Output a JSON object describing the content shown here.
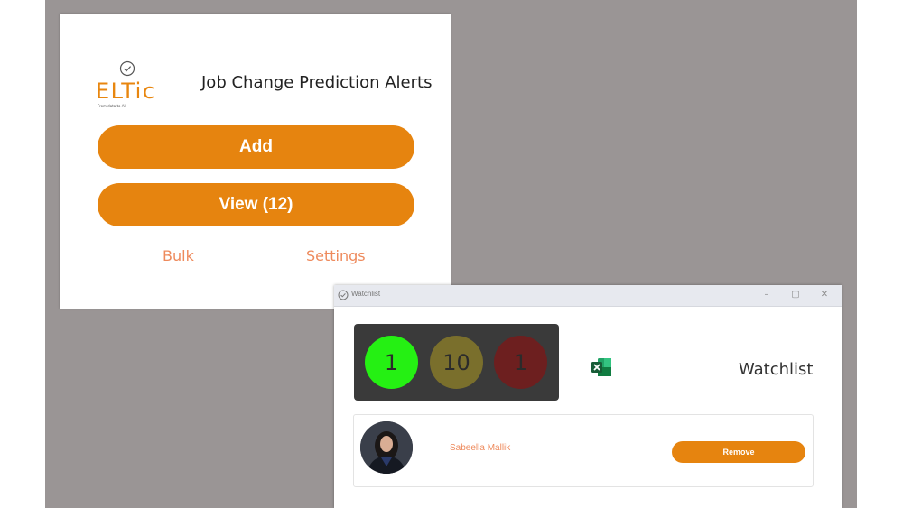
{
  "popup": {
    "logo_text": "ELTic",
    "logo_tagline": "From data to AI",
    "title": "Job Change Prediction Alerts",
    "add_label": "Add",
    "view_label": "View (12)",
    "bulk_label": "Bulk",
    "settings_label": "Settings"
  },
  "watchlist": {
    "window_title": "Watchlist",
    "controls": {
      "minimize": "–",
      "maximize": "▢",
      "close": "✕"
    },
    "stats": {
      "green": "1",
      "olive": "10",
      "red": "1"
    },
    "header": "Watchlist",
    "entry": {
      "name": "Sabeella Mallik",
      "remove_label": "Remove"
    }
  },
  "colors": {
    "accent": "#e6840f",
    "link": "#ee8a5c",
    "backdrop": "#9a9595",
    "stat_green": "#25f013",
    "stat_olive": "#7a6f2c",
    "stat_red": "#6d1f1f"
  }
}
